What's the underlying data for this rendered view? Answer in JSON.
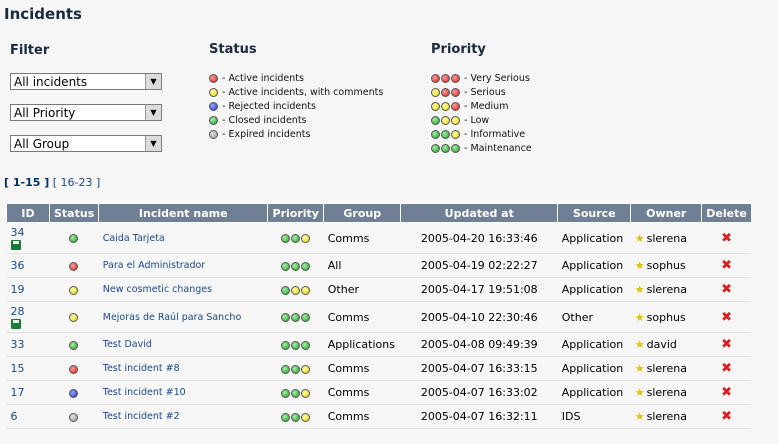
{
  "page_title": "Incidents",
  "filter": {
    "title": "Filter",
    "selects": [
      "All incidents",
      "All Priority",
      "All Group"
    ]
  },
  "status_legend": {
    "title": "Status",
    "items": [
      {
        "color": "red",
        "label": "- Active incidents"
      },
      {
        "color": "yellow",
        "label": "- Active incidents, with comments"
      },
      {
        "color": "blue",
        "label": "- Rejected incidents"
      },
      {
        "color": "green",
        "label": "- Closed incidents"
      },
      {
        "color": "gray",
        "label": "- Expired incidents"
      }
    ]
  },
  "priority_legend": {
    "title": "Priority",
    "items": [
      {
        "dots": [
          "red",
          "red",
          "red"
        ],
        "label": "- Very Serious"
      },
      {
        "dots": [
          "yellow",
          "red",
          "red"
        ],
        "label": "- Serious"
      },
      {
        "dots": [
          "yellow",
          "yellow",
          "red"
        ],
        "label": "- Medium"
      },
      {
        "dots": [
          "green",
          "yellow",
          "yellow"
        ],
        "label": "- Low"
      },
      {
        "dots": [
          "green",
          "green",
          "yellow"
        ],
        "label": "- Informative"
      },
      {
        "dots": [
          "green",
          "green",
          "green"
        ],
        "label": "- Maintenance"
      }
    ]
  },
  "pager": {
    "current": "[ 1-15 ]",
    "next": "[ 16-23 ]"
  },
  "table": {
    "headers": [
      "ID",
      "Status",
      "Incident name",
      "Priority",
      "Group",
      "Updated at",
      "Source",
      "Owner",
      "Delete"
    ],
    "rows": [
      {
        "id": "34",
        "saved": true,
        "status": "green",
        "name": "Caida Tarjeta",
        "priority": [
          "green",
          "green",
          "yellow"
        ],
        "group": "Comms",
        "updated": "2005-04-20 16:33:46",
        "source": "Application",
        "owner": "slerena"
      },
      {
        "id": "36",
        "saved": false,
        "status": "red",
        "name": "Para el Administrador",
        "priority": [
          "green",
          "green",
          "green"
        ],
        "group": "All",
        "updated": "2005-04-19 02:22:27",
        "source": "Application",
        "owner": "sophus"
      },
      {
        "id": "19",
        "saved": false,
        "status": "yellow",
        "name": "New cosmetic changes",
        "priority": [
          "green",
          "yellow",
          "yellow"
        ],
        "group": "Other",
        "updated": "2005-04-17 19:51:08",
        "source": "Application",
        "owner": "slerena"
      },
      {
        "id": "28",
        "saved": true,
        "status": "yellow",
        "name": "Mejoras de Raúl para Sancho",
        "priority": [
          "green",
          "green",
          "green"
        ],
        "group": "Comms",
        "updated": "2005-04-10 22:30:46",
        "source": "Other",
        "owner": "sophus"
      },
      {
        "id": "33",
        "saved": false,
        "status": "green",
        "name": "Test David",
        "priority": [
          "green",
          "green",
          "green"
        ],
        "group": "Applications",
        "updated": "2005-04-08 09:49:39",
        "source": "Application",
        "owner": "david"
      },
      {
        "id": "15",
        "saved": false,
        "status": "red",
        "name": "Test incident #8",
        "priority": [
          "green",
          "green",
          "yellow"
        ],
        "group": "Comms",
        "updated": "2005-04-07 16:33:15",
        "source": "Application",
        "owner": "slerena"
      },
      {
        "id": "17",
        "saved": false,
        "status": "blue",
        "name": "Test incident #10",
        "priority": [
          "green",
          "green",
          "yellow"
        ],
        "group": "Comms",
        "updated": "2005-04-07 16:33:02",
        "source": "Application",
        "owner": "slerena"
      },
      {
        "id": "6",
        "saved": false,
        "status": "gray",
        "name": "Test incident #2",
        "priority": [
          "green",
          "green",
          "yellow"
        ],
        "group": "Comms",
        "updated": "2005-04-07 16:32:11",
        "source": "IDS",
        "owner": "slerena"
      }
    ]
  },
  "icons": {
    "delete": "✖",
    "owner": "★",
    "saved": "floppy-disk-icon"
  }
}
